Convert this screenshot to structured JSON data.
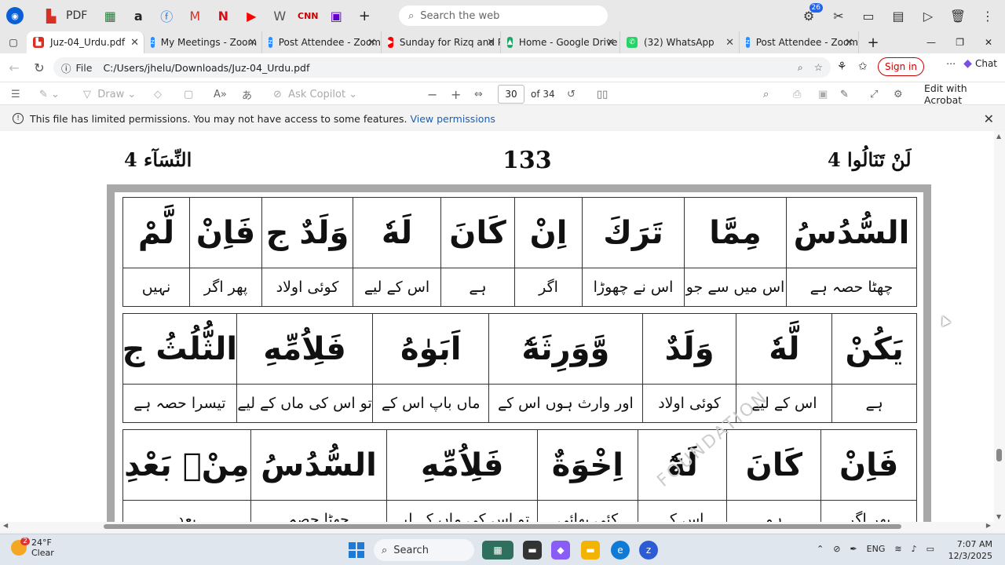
{
  "appbar": {
    "pdf_label": "PDF",
    "search_placeholder": "Search the web",
    "badge_count": "26"
  },
  "tabs": [
    {
      "label": "Juz-04_Urdu.pdf",
      "color": "#d93025",
      "icon": "pdf-icon",
      "active": true
    },
    {
      "label": "My Meetings - Zoom",
      "color": "#2d8cff",
      "icon": "zoom-icon"
    },
    {
      "label": "Post Attendee - Zoom",
      "color": "#2d8cff",
      "icon": "zoom-icon"
    },
    {
      "label": "Sunday for Rizq and Pr",
      "color": "#ff0000",
      "icon": "youtube-icon"
    },
    {
      "label": "Home - Google Drive",
      "color": "#1fa463",
      "icon": "drive-icon"
    },
    {
      "label": "(32) WhatsApp",
      "color": "#25d366",
      "icon": "whatsapp-icon"
    },
    {
      "label": "Post Attendee - Zoom",
      "color": "#2d8cff",
      "icon": "zoom-icon"
    }
  ],
  "address": {
    "scheme_label": "File",
    "path": "C:/Users/jhelu/Downloads/Juz-04_Urdu.pdf",
    "signin_label": "Sign in",
    "chat_label": "Chat"
  },
  "pdf_toolbar": {
    "draw_label": "Draw",
    "ask_copilot_label": "Ask Copilot",
    "page_current": "30",
    "page_total": "of 34",
    "edit_acrobat_label": "Edit with Acrobat"
  },
  "permission_banner": {
    "message": "This file has limited permissions. You may not have access to some features.",
    "link": "View permissions"
  },
  "pdf_page": {
    "header_left": "النِّسَآء 4",
    "header_center": "133",
    "header_right": "لَنْ تَنَالُوا 4",
    "watermark": "FOUNDATION",
    "blocks": [
      {
        "arabic": [
          "السُّدُسُ",
          "مِمَّا",
          "تَرَكَ",
          "اِنْ",
          "كَانَ",
          "لَهٗ",
          "وَلَدٌ ج",
          "فَاِنْ",
          "لَّمْ"
        ],
        "urdu": [
          "چھٹا حصہ ہے",
          "اس میں سے جو",
          "اس نے چھوڑا",
          "اگر",
          "ہے",
          "اس کے لیے",
          "کوئی اولاد",
          "پھر اگر",
          "نہیں"
        ],
        "widths": [
          166,
          130,
          130,
          86,
          94,
          112,
          116,
          92,
          84
        ]
      },
      {
        "arabic": [
          "يَكُنْ",
          "لَّهٗ",
          "وَلَدٌ",
          "وَّوَرِثَهٗٓ",
          "اَبَوٰهُ",
          "فَلِاُمِّهِ",
          "الثُّلُثُ ج"
        ],
        "urdu": [
          "ہے",
          "اس کے لیے",
          "کوئی اولاد",
          "اور وارث ہوں اس کے",
          "ماں باپ اس کے",
          "تو اس کی ماں کے لیے",
          "تیسرا حصہ ہے"
        ],
        "widths": [
          108,
          122,
          120,
          196,
          148,
          174,
          144
        ]
      },
      {
        "arabic": [
          "فَاِنْ",
          "كَانَ",
          "لَهٗٓ",
          "اِخْوَةٌ",
          "فَلِاُمِّهِ",
          "السُّدُسُ",
          "مِنْۢ بَعْدِ"
        ],
        "urdu": [
          "پھر اگر",
          "ہو",
          "اس کے",
          "کئی بھائی",
          "تو اس کی ماں کے لیے",
          "چھٹا حصہ",
          "بعد"
        ],
        "widths": [
          122,
          120,
          114,
          128,
          192,
          174,
          162
        ]
      }
    ]
  },
  "taskbar": {
    "temperature": "24°F",
    "condition": "Clear",
    "weather_badge": "2",
    "search_label": "Search",
    "language": "ENG",
    "time": "7:07 AM",
    "date": "12/3/2025"
  }
}
